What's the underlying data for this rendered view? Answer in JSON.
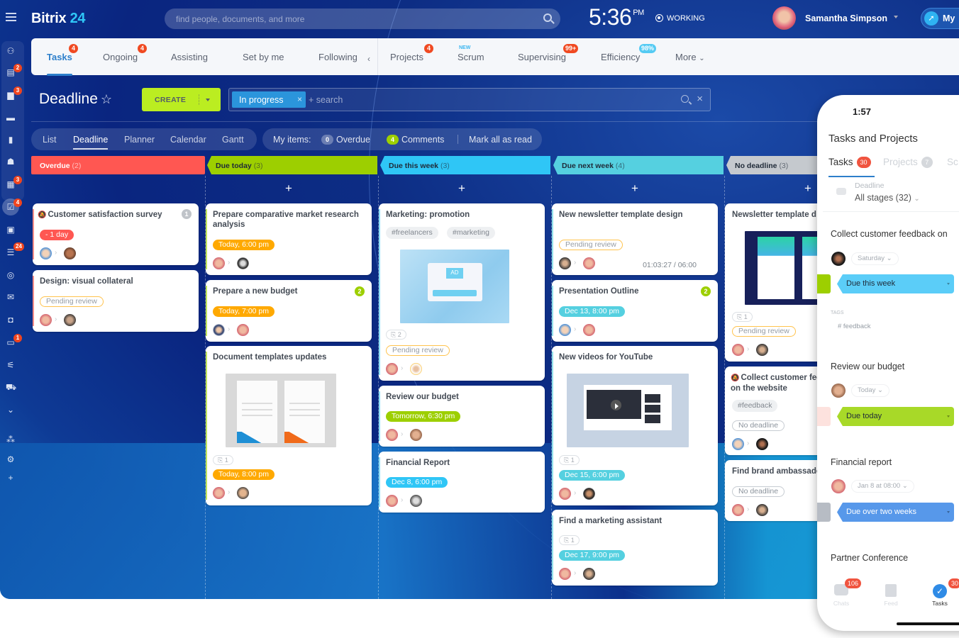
{
  "brand": {
    "name": "Bitrix",
    "num": "24"
  },
  "search": {
    "placeholder": "find people, documents, and more"
  },
  "clock": {
    "time": "5:36",
    "ampm": "PM"
  },
  "status": "WORKING",
  "user": {
    "name": "Samantha Simpson"
  },
  "my_pill": "My",
  "rail_badges": {
    "b1": "2",
    "b2": "3",
    "b6": "3",
    "b7": "4",
    "b9": "24",
    "b13": "1"
  },
  "tabs": [
    {
      "label": "Tasks",
      "badge": "4"
    },
    {
      "label": "Ongoing",
      "badge": "4"
    },
    {
      "label": "Assisting"
    },
    {
      "label": "Set by me"
    },
    {
      "label": "Following"
    },
    {
      "label": "Projects",
      "badge": "4"
    },
    {
      "label": "Scrum",
      "badge": "NEW"
    },
    {
      "label": "Supervising",
      "badge": "99+"
    },
    {
      "label": "Efficiency",
      "badge": "98%"
    },
    {
      "label": "More"
    }
  ],
  "page": {
    "title": "Deadline",
    "create": "CREATE"
  },
  "filter": {
    "chip": "In progress",
    "placeholder": "+ search"
  },
  "views": [
    "List",
    "Deadline",
    "Planner",
    "Calendar",
    "Gantt"
  ],
  "my_items": {
    "label": "My items:",
    "overdue_count": "0",
    "overdue": "Overdue",
    "comments_count": "4",
    "comments": "Comments",
    "mark_read": "Mark all as read"
  },
  "colors": {
    "overdue": "#ff5752",
    "today": "#9dcf00",
    "week": "#2fc6f6",
    "next": "#55d0e0",
    "none": "#a8adb4",
    "accent": "#2d7fcb",
    "create": "#bbed21"
  },
  "columns": [
    {
      "title": "Overdue",
      "count": "(2)"
    },
    {
      "title": "Due today",
      "count": "(3)"
    },
    {
      "title": "Due this week",
      "count": "(3)"
    },
    {
      "title": "Due next week",
      "count": "(4)"
    },
    {
      "title": "No deadline",
      "count": "(3)"
    }
  ],
  "cards": {
    "c1": {
      "title": "Customer satisfaction survey",
      "deadline": "- 1 day",
      "comments": "1"
    },
    "c2": {
      "title": "Design: visual collateral",
      "status": "Pending review"
    },
    "c3": {
      "title": "Prepare comparative market research analysis",
      "deadline": "Today, 6:00 pm"
    },
    "c4": {
      "title": "Prepare a new budget",
      "deadline": "Today, 7:00 pm",
      "comments": "2"
    },
    "c5": {
      "title": "Document templates updates",
      "files": "1",
      "deadline": "Today, 8:00 pm"
    },
    "c6": {
      "title": "Marketing: promotion",
      "tags": [
        "#freelancers",
        "#marketing"
      ],
      "files": "2",
      "status": "Pending review",
      "thumb_text": "AD"
    },
    "c7": {
      "title": "Review our budget",
      "deadline": "Tomorrow, 6:30 pm"
    },
    "c8": {
      "title": "Financial Report",
      "deadline": "Dec 8, 6:00 pm"
    },
    "c9": {
      "title": "New newsletter template design",
      "status": "Pending review",
      "timer": "01:03:27 / 06:00"
    },
    "c10": {
      "title": "Presentation Outline",
      "deadline": "Dec 13, 8:00 pm",
      "comments": "2"
    },
    "c11": {
      "title": "New videos for YouTube",
      "files": "1",
      "deadline": "Dec 15, 6:00 pm"
    },
    "c12": {
      "title": "Find a marketing assistant",
      "files": "1",
      "deadline": "Dec 17, 9:00 pm"
    },
    "c13": {
      "title": "Newsletter template d",
      "files": "1",
      "status": "Pending review"
    },
    "c14": {
      "title": "Collect customer fee on the website",
      "tag": "#feedback",
      "status": "No deadline"
    },
    "c15": {
      "title": "Find brand ambassado",
      "status": "No deadline"
    }
  },
  "phone": {
    "time": "1:57",
    "title": "Tasks and Projects",
    "tabs": [
      {
        "label": "Tasks",
        "badge": "30"
      },
      {
        "label": "Projects",
        "badge": "7"
      },
      {
        "label": "Sc"
      }
    ],
    "filter_label": "Deadline",
    "stages": "All stages (32)",
    "tasks": [
      {
        "title": "Collect customer feedback on",
        "when": "Saturday",
        "stage": "Due this week"
      },
      {
        "title": "Review our budget",
        "when": "Today",
        "stage": "Due today"
      },
      {
        "title": "Financial report",
        "when": "Jan 8 at 08:00",
        "stage": "Due over two weeks"
      },
      {
        "title": "Partner Conference"
      }
    ],
    "tags_label": "TAGS",
    "tag": "# feedback",
    "nav": [
      {
        "label": "Chats",
        "badge": "106"
      },
      {
        "label": "Feed"
      },
      {
        "label": "Tasks",
        "badge": "30"
      }
    ]
  }
}
